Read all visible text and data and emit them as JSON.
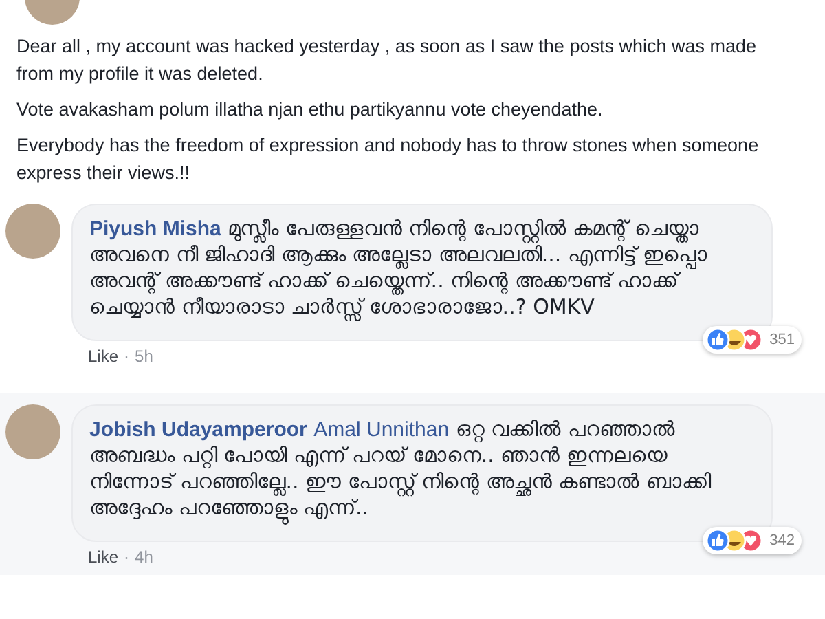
{
  "post": {
    "paragraphs": [
      "Dear all , my account was hacked yesterday , as soon as I saw the posts which was made from my profile it was deleted.",
      "Vote avakasham polum illatha njan ethu partikyannu vote cheyendathe.",
      "Everybody has the freedom of expression and nobody has to throw stones when someone express their views.!!"
    ]
  },
  "comments": [
    {
      "author": "Piyush Misha",
      "text": "മുസ്ലീം പേരുള്ളവൻ നിന്റെ പോസ്റ്റിൽ കമന്റ് ചെയ്താ അവനെ നീ ജിഹാദി ആക്കും അല്ലേടാ അലവലതി... എന്നിട്ട് ഇപ്പൊ അവന്റ് അക്കൗണ്ട് ഹാക്ക് ചെയ്തെന്ന്.. നിന്റെ അക്കൗണ്ട് ഹാക്ക് ചെയ്യാൻ നീയാരാടാ ചാർസ്സ് ശോഭാരാജോ..? OMKV",
      "like": "Like",
      "separator": "·",
      "time": "5h",
      "reactions": "351"
    },
    {
      "author": "Jobish Udayamperoor",
      "mention": "Amal Unnithan",
      "text": "ഒറ്റ വക്കിൽ പറഞ്ഞാൽ അബദ്ധം പറ്റി പോയി എന്ന് പറയ് മോനെ.. ഞാൻ ഇന്നലയെ നിന്നോട് പറഞ്ഞില്ലേ.. ഈ പോസ്റ്റ് നിന്റെ അച്ഛൻ കണ്ടാൽ ബാക്കി അദ്ദേഹം പറഞ്ഞോളും എന്ന്..",
      "like": "Like",
      "separator": "·",
      "time": "4h",
      "reactions": "342"
    }
  ]
}
